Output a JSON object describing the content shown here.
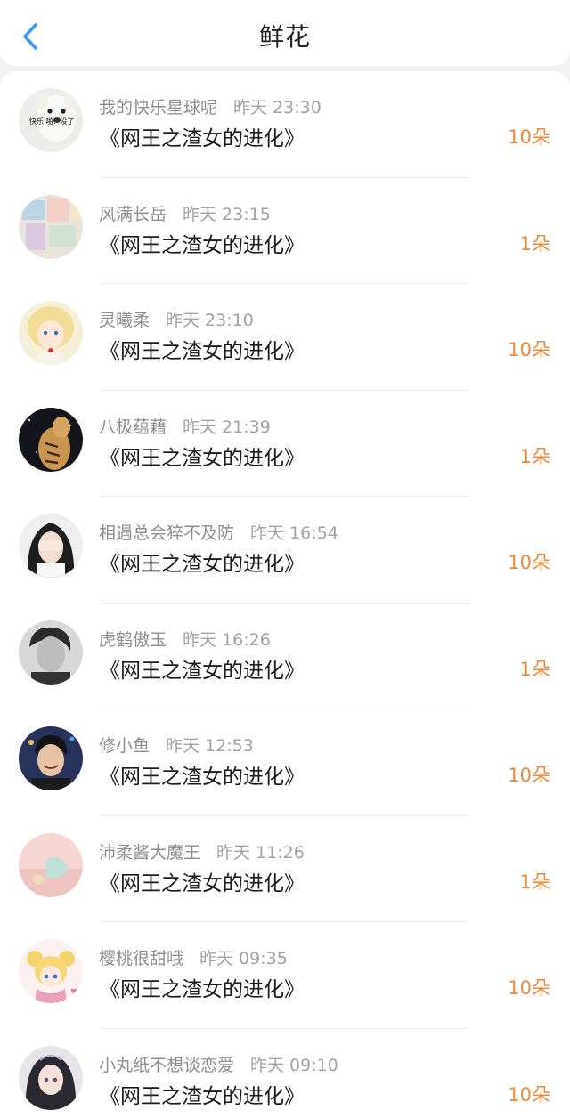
{
  "header": {
    "title": "鲜花"
  },
  "colors": {
    "accent_blue": "#3a9af2",
    "count_orange": "#ec8a3b"
  },
  "items": [
    {
      "user": "我的快乐星球呢",
      "time": "昨天 23:30",
      "book": "《网王之渣女的进化》",
      "count": "10朵",
      "avatar_icon": "dog-meme-avatar",
      "avatar_text": "快乐 啪！没了"
    },
    {
      "user": "风满长岳",
      "time": "昨天 23:15",
      "book": "《网王之渣女的进化》",
      "count": "1朵",
      "avatar_icon": "collage-photo-avatar"
    },
    {
      "user": "灵曦柔",
      "time": "昨天 23:10",
      "book": "《网王之渣女的进化》",
      "count": "10朵",
      "avatar_icon": "anime-blonde-girl-avatar"
    },
    {
      "user": "八极蕴藉",
      "time": "昨天 21:39",
      "book": "《网王之渣女的进化》",
      "count": "1朵",
      "avatar_icon": "tiger-avatar"
    },
    {
      "user": "相遇总会猝不及防",
      "time": "昨天 16:54",
      "book": "《网王之渣女的进化》",
      "count": "10朵",
      "avatar_icon": "girl-covering-face-avatar"
    },
    {
      "user": "虎鹤傲玉",
      "time": "昨天 16:26",
      "book": "《网王之渣女的进化》",
      "count": "1朵",
      "avatar_icon": "bw-portrait-avatar"
    },
    {
      "user": "修小鱼",
      "time": "昨天 12:53",
      "book": "《网王之渣女的进化》",
      "count": "10朵",
      "avatar_icon": "smiling-boy-avatar"
    },
    {
      "user": "沛柔酱大魔王",
      "time": "昨天 11:26",
      "book": "《网王之渣女的进化》",
      "count": "1朵",
      "avatar_icon": "pastel-pink-avatar"
    },
    {
      "user": "樱桃很甜哦",
      "time": "昨天 09:35",
      "book": "《网王之渣女的进化》",
      "count": "10朵",
      "avatar_icon": "sailor-moon-avatar"
    },
    {
      "user": "小丸纸不想谈恋爱",
      "time": "昨天 09:10",
      "book": "《网王之渣女的进化》",
      "count": "10朵",
      "avatar_icon": "anime-dark-hair-girl-avatar"
    }
  ]
}
